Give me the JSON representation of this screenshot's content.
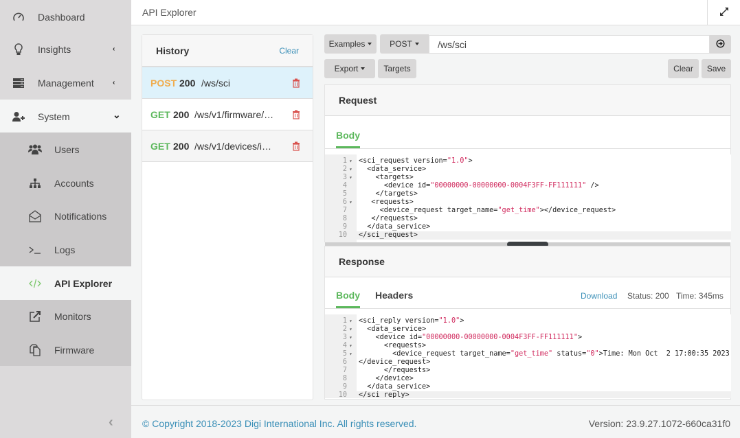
{
  "sidebar": {
    "items": [
      {
        "label": "Dashboard",
        "icon": "dashboard-gauge-icon"
      },
      {
        "label": "Insights",
        "icon": "lightbulb-icon",
        "chevron": "‹"
      },
      {
        "label": "Management",
        "icon": "server-stack-icon",
        "chevron": "‹"
      },
      {
        "label": "System",
        "icon": "user-plus-icon",
        "chevron": "⌄"
      }
    ],
    "submenu": [
      {
        "label": "Users",
        "icon": "users-icon"
      },
      {
        "label": "Accounts",
        "icon": "sitemap-icon"
      },
      {
        "label": "Notifications",
        "icon": "envelope-open-icon"
      },
      {
        "label": "Logs",
        "icon": "terminal-icon"
      },
      {
        "label": "API Explorer",
        "icon": "code-icon",
        "active": true
      },
      {
        "label": "Monitors",
        "icon": "external-link-icon"
      },
      {
        "label": "Firmware",
        "icon": "copy-icon"
      }
    ],
    "collapse": "‹"
  },
  "topbar": {
    "title": "API Explorer"
  },
  "history": {
    "title": "History",
    "clear_label": "Clear",
    "rows": [
      {
        "method": "POST",
        "status": "200",
        "path": "/ws/sci",
        "method_color": "#f0ad4e"
      },
      {
        "method": "GET",
        "status": "200",
        "path": "/ws/v1/firmware/…",
        "method_color": "#5cb85c"
      },
      {
        "method": "GET",
        "status": "200",
        "path": "/ws/v1/devices/i…",
        "method_color": "#5cb85c"
      }
    ]
  },
  "toolbar": {
    "examples_label": "Examples",
    "method_label": "POST",
    "url_value": "/ws/sci",
    "export_label": "Export",
    "targets_label": "Targets",
    "clear_label": "Clear",
    "save_label": "Save"
  },
  "request": {
    "title": "Request",
    "tab_body": "Body",
    "lines": [
      {
        "n": "1",
        "fold": true,
        "indent": "",
        "parts": [
          [
            "t",
            "<sci_request version="
          ],
          [
            "s",
            "\"1.0\""
          ],
          [
            "t",
            ">"
          ]
        ]
      },
      {
        "n": "2",
        "fold": true,
        "indent": "  ",
        "parts": [
          [
            "t",
            "<data_service>"
          ]
        ]
      },
      {
        "n": "3",
        "fold": true,
        "indent": "    ",
        "parts": [
          [
            "t",
            "<targets>"
          ]
        ]
      },
      {
        "n": "4",
        "fold": false,
        "indent": "      ",
        "parts": [
          [
            "t",
            "<device id="
          ],
          [
            "s",
            "\"00000000-00000000-0004F3FF-FF111111\""
          ],
          [
            "t",
            " />"
          ]
        ]
      },
      {
        "n": "5",
        "fold": false,
        "indent": "    ",
        "parts": [
          [
            "t",
            "</targets>"
          ]
        ]
      },
      {
        "n": "6",
        "fold": true,
        "indent": "   ",
        "parts": [
          [
            "t",
            "<requests>"
          ]
        ]
      },
      {
        "n": "7",
        "fold": false,
        "indent": "     ",
        "parts": [
          [
            "t",
            "<device_request target_name="
          ],
          [
            "s",
            "\"get_time\""
          ],
          [
            "t",
            "></device_request>"
          ]
        ]
      },
      {
        "n": "8",
        "fold": false,
        "indent": "   ",
        "parts": [
          [
            "t",
            "</requests>"
          ]
        ]
      },
      {
        "n": "9",
        "fold": false,
        "indent": "  ",
        "parts": [
          [
            "t",
            "</data_service>"
          ]
        ]
      },
      {
        "n": "10",
        "fold": false,
        "indent": "",
        "parts": [
          [
            "t",
            "</sci_request>"
          ]
        ]
      }
    ]
  },
  "response": {
    "title": "Response",
    "tab_body": "Body",
    "tab_headers": "Headers",
    "download_label": "Download",
    "status_text": "Status: 200",
    "time_text": "Time: 345ms",
    "lines": [
      {
        "n": "1",
        "fold": true,
        "indent": "",
        "parts": [
          [
            "t",
            "<sci_reply version="
          ],
          [
            "s",
            "\"1.0\""
          ],
          [
            "t",
            ">"
          ]
        ]
      },
      {
        "n": "2",
        "fold": true,
        "indent": "  ",
        "parts": [
          [
            "t",
            "<data_service>"
          ]
        ]
      },
      {
        "n": "3",
        "fold": true,
        "indent": "    ",
        "parts": [
          [
            "t",
            "<device id="
          ],
          [
            "s",
            "\"00000000-00000000-0004F3FF-FF111111\""
          ],
          [
            "t",
            ">"
          ]
        ]
      },
      {
        "n": "4",
        "fold": true,
        "indent": "      ",
        "parts": [
          [
            "t",
            "<requests>"
          ]
        ]
      },
      {
        "n": "5",
        "fold": true,
        "indent": "        ",
        "parts": [
          [
            "t",
            "<device_request target_name="
          ],
          [
            "s",
            "\"get_time\""
          ],
          [
            "t",
            " status="
          ],
          [
            "s",
            "\"0\""
          ],
          [
            "t",
            ">Time: Mon Oct  2 17:00:35 2023"
          ]
        ]
      },
      {
        "n": "6",
        "fold": false,
        "indent": "",
        "parts": [
          [
            "t",
            "</device_request>"
          ]
        ]
      },
      {
        "n": "7",
        "fold": false,
        "indent": "      ",
        "parts": [
          [
            "t",
            "</requests>"
          ]
        ]
      },
      {
        "n": "8",
        "fold": false,
        "indent": "    ",
        "parts": [
          [
            "t",
            "</device>"
          ]
        ]
      },
      {
        "n": "9",
        "fold": false,
        "indent": "  ",
        "parts": [
          [
            "t",
            "</data_service>"
          ]
        ]
      },
      {
        "n": "10",
        "fold": false,
        "indent": "",
        "parts": [
          [
            "t",
            "</sci_reply>"
          ]
        ]
      }
    ]
  },
  "footer": {
    "copyright": "© Copyright 2018-2023 Digi International Inc. All rights reserved.",
    "version": "Version: 23.9.27.1072-660ca31f0"
  }
}
